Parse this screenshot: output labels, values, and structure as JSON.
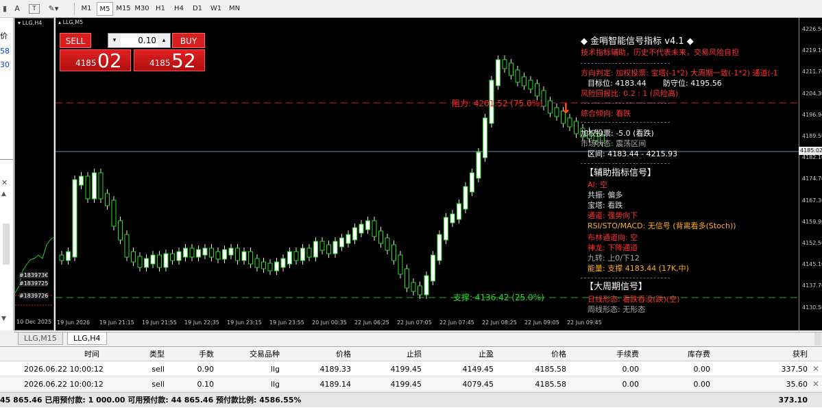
{
  "toolbar": {
    "timeframes": [
      "M1",
      "M5",
      "M15",
      "M30",
      "H1",
      "H4",
      "D1",
      "W1",
      "MN"
    ],
    "active_timeframe": "M5",
    "text_tool": "A"
  },
  "left_panel": {
    "labels": [
      "价",
      "58",
      "30"
    ]
  },
  "h4_window": {
    "title": "LLG,H4",
    "order_labels": [
      "#183973€",
      "#1839725",
      "#1839726"
    ],
    "date_label": "10 Dec 2025"
  },
  "m5_window": {
    "title": "LLG,M5",
    "trade": {
      "sell_label": "SELL",
      "buy_label": "BUY",
      "lot": "0.10",
      "sell_small": "4185",
      "sell_big": "02",
      "buy_small": "4185",
      "buy_big": "52"
    },
    "resistance_label": "阻力: 4201.52 (75.0%)",
    "support_label": "支撑: 4136.42 (25.0%)",
    "current_price_tag": "4185.02",
    "y_ticks": [
      "4226.50",
      "4219.10",
      "4211.70",
      "4204.30",
      "4196.90",
      "4189.50",
      "4182.10",
      "4174.70",
      "4167.30",
      "4159.90",
      "4152.50",
      "4145.10",
      "4137.70",
      "4130.50"
    ],
    "x_ticks": [
      "19 Jun 2026",
      "19 Jun 21:15",
      "19 Jun 21:55",
      "19 Jun 22:35",
      "19 Jun 23:15",
      "19 Jun 23:55",
      "20 Jun 00:35",
      "22 Jun 06:25",
      "22 Jun 07:05",
      "22 Jun 07:45",
      "22 Jun 08:25",
      "22 Jun 09:05",
      "22 Jun 09:45"
    ]
  },
  "indicator": {
    "title": "◆ 金哨智能信号指标 v4.1 ◆",
    "subtitle": "技术指标辅助，历史不代表未来，交易风险自担",
    "direction": "方向判定: 加权投票: 宝塔(-1*2) 大周期一致(-1*2) 通道(-1",
    "target": "目标位: 4183.44",
    "stop": "防守位: 4195.56",
    "risk_reward": "风险回报比: 0.2 : 1 (风险高)",
    "overall": "综合倾向: 看跌",
    "weighted_vote": "加权投票: -5.0 (看跌)",
    "market_state": "市场状态: 震荡区间",
    "range": "区间: 4183.44 - 4215.93",
    "aux_header": "【辅助指标信号】",
    "ai": "AI: 空",
    "resonance": "共振: 偏多",
    "tower": "宝塔: 看跌",
    "channel": "通道: 强势向下",
    "rsi": "RSI/STO/MACD: 无信号 (背离看多(Stoch))",
    "bollinger": "布林通道向: 空",
    "dragon": "神龙: 下降通道",
    "nine": "九转: 上0/下12",
    "energy": "能量: 支撑 4183.44 (17K,中)",
    "big_header": "【大周期信号】",
    "daily": "日线形态: 看跌吞没(跌)(空)",
    "weekly": "周线形态: 无形态"
  },
  "tabs": [
    "LLG,M15",
    "LLG,H4"
  ],
  "active_tab": "LLG,H4",
  "orders": {
    "headers": [
      "时间",
      "类型",
      "手数",
      "交易品种",
      "价格",
      "止损",
      "止盈",
      "价格",
      "手续费",
      "库存费",
      "获利"
    ],
    "rows": [
      [
        "2026.06.22 10:00:12",
        "sell",
        "0.90",
        "llg",
        "4189.33",
        "4199.45",
        "4149.45",
        "4185.58",
        "0.00",
        "0.00",
        "337.50"
      ],
      [
        "2026.06.22 10:00:12",
        "sell",
        "0.10",
        "llg",
        "4189.14",
        "4199.45",
        "4079.45",
        "4185.58",
        "0.00",
        "0.00",
        "35.60"
      ]
    ],
    "summary": "45 865.46  已用预付款: 1 000.00  可用预付款: 44 865.46  预付款比例: 4586.55%",
    "total_profit": "373.10"
  }
}
